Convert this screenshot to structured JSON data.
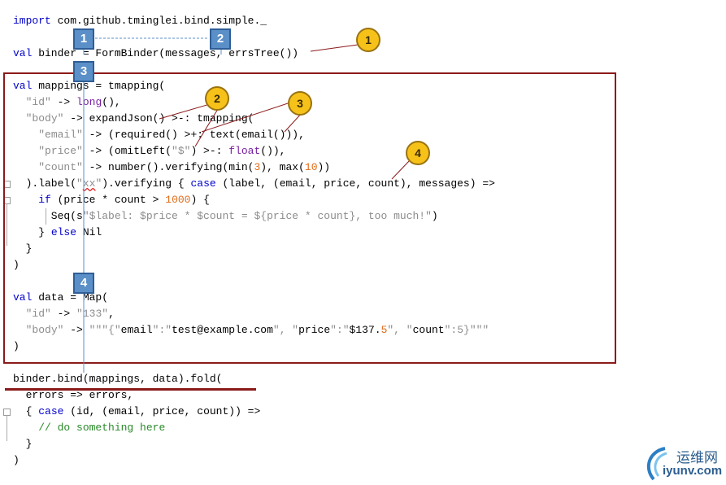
{
  "code_lines": [
    "import com.github.tminglei.bind.simple._",
    "val binder = FormBinder(messages, errsTree())",
    "val mappings = tmapping(",
    "  \"id\" -> long(),",
    "  \"body\" -> expandJson() >-: tmapping(",
    "    \"email\" -> (required() >+: text(email())),",
    "    \"price\" -> (omitLeft(\"$\") >-: float()),",
    "    \"count\" -> number().verifying(min(3), max(10))",
    "  ).label(\"xx\").verifying { case (label, (email, price, count), messages) =>",
    "    if (price * count > 1000) {",
    "      Seq(s\"$label: $price * $count = ${price * count}, too much!\")",
    "    } else Nil",
    "  }",
    ")",
    "val data = Map(",
    "  \"id\" -> \"133\",",
    "  \"body\" -> \"\"\"{\"email\":\"test@example.com\", \"price\":\"$137.5\", \"count\":5}\"\"\"",
    ")",
    "binder.bind(mappings, data).fold(",
    "  errors => errors,",
    "  { case (id, (email, price, count)) =>",
    "    // do something here",
    "  }",
    ")"
  ],
  "annotations": {
    "square_1": "1",
    "square_2": "2",
    "square_3": "3",
    "square_4": "4",
    "circle_1": "1",
    "circle_2": "2",
    "circle_3": "3",
    "circle_4": "4"
  },
  "watermark": {
    "cn": "运维网",
    "en": "iyunv.com"
  },
  "colors": {
    "keyword": "#0000cc",
    "string": "#8c8c8c",
    "number": "#e06c1a",
    "comment": "#2a8a2a",
    "function": "#7a1fa2",
    "frame": "#8b1a1a",
    "badge_square": "#5b8fc7",
    "badge_circle": "#f6c21a"
  }
}
